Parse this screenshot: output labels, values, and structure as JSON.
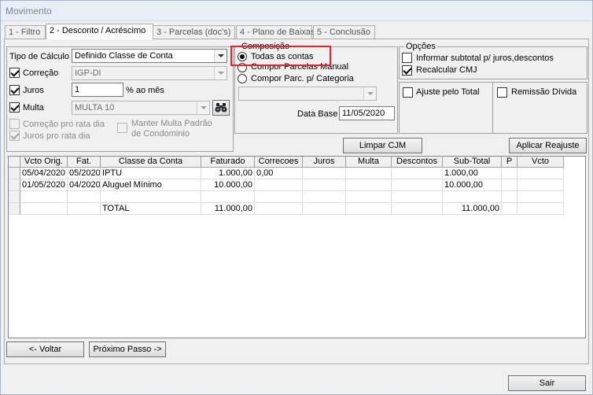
{
  "window": {
    "title": "Movimento"
  },
  "tabs": [
    {
      "label": "1 - Filtro"
    },
    {
      "label": "2 - Desconto / Acréscimo"
    },
    {
      "label": "3 - Parcelas (doc's)"
    },
    {
      "label": "4 - Plano de Baixas"
    },
    {
      "label": "5 - Conclusão"
    }
  ],
  "calc": {
    "tipo_label": "Tipo de Cálculo",
    "tipo_value": "Definido Classe de Conta",
    "correcao_label": "Correção",
    "correcao_value": "IGP-DI",
    "juros_label": "Juros",
    "juros_value": "1",
    "juros_unit": "% ao mês",
    "multa_label": "Multa",
    "multa_value": "MULTA 10",
    "correcao_pro_rata": "Correção pro rata dia",
    "juros_pro_rata": "Juros pro rata dia",
    "manter_multa_1": "Manter Multa Padrão",
    "manter_multa_2": "de Condominio"
  },
  "composicao": {
    "title": "Composição",
    "opt1": "Todas as contas",
    "opt2": "Compor Parcelas Manual",
    "opt3": "Compor Parc. p/ Categoria",
    "data_base_label": "Data Base",
    "data_base_value": "11/05/2020"
  },
  "opcoes": {
    "title": "Opções",
    "opt1": "Informar subtotal p/ juros,descontos",
    "opt2": "Recalcular CMJ",
    "ajuste": "Ajuste pelo Total",
    "remissao": "Remissão Dívida"
  },
  "buttons": {
    "limpar": "Limpar CJM",
    "aplicar": "Aplicar Reajuste",
    "voltar": "<- Voltar",
    "proximo": "Próximo Passo ->",
    "sair": "Sair"
  },
  "table": {
    "headers": [
      "Vcto Orig.",
      "Fat.",
      "Classe da Conta",
      "Faturado",
      "Correcoes",
      "Juros",
      "Multa",
      "Descontos",
      "Sub-Total",
      "P",
      "Vcto"
    ],
    "rows": [
      [
        "05/04/2020",
        "05/2020",
        "IPTU",
        "1.000,00",
        "0,00",
        "",
        "",
        "",
        "1.000,00",
        "",
        ""
      ],
      [
        "01/05/2020",
        "04/2020",
        "Aluguel Mínimo",
        "10.000,00",
        "",
        "",
        "",
        "",
        "10.000,00",
        "",
        ""
      ],
      [
        "",
        "",
        "",
        "",
        "",
        "",
        "",
        "",
        "",
        "",
        ""
      ],
      [
        "",
        "",
        "TOTAL",
        "11.000,00",
        "",
        "",
        "",
        "",
        "11.000,00",
        "",
        ""
      ]
    ]
  }
}
